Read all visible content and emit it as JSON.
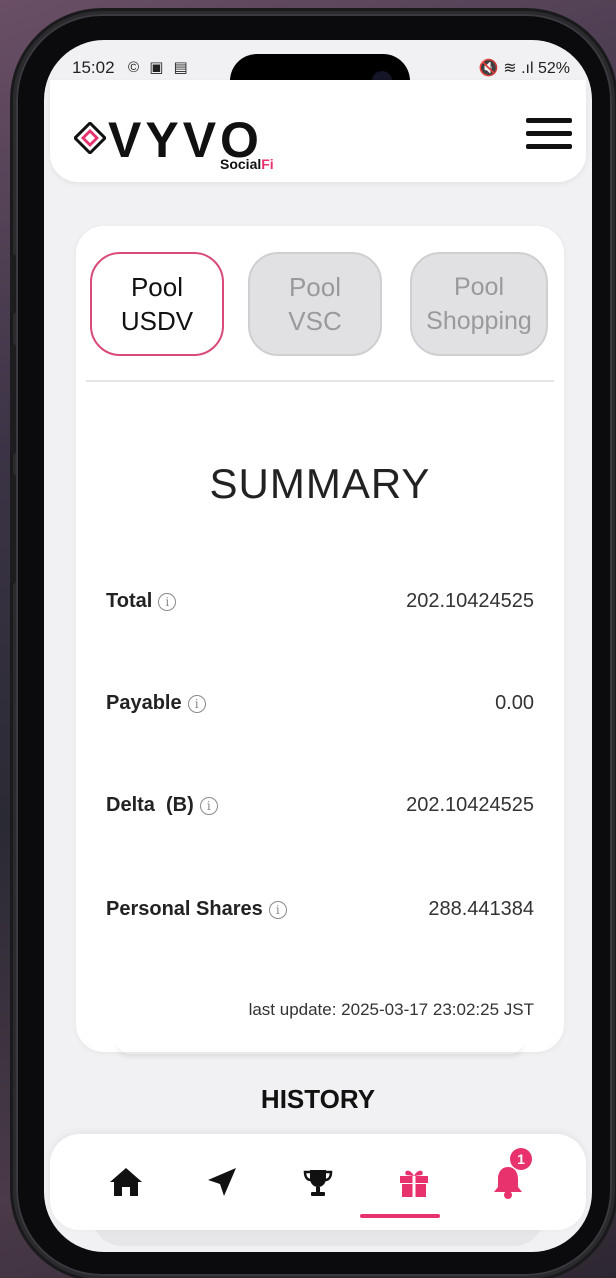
{
  "statusbar": {
    "time": "15:02",
    "left_icons": "© ▣ ▤",
    "right": "🔇 ≋ .ıl 52%"
  },
  "app": {
    "logo_text": "VYVO",
    "logo_sub_a": "Social",
    "logo_sub_b": "Fi",
    "accent": "#e8326e"
  },
  "tabs": [
    {
      "line1": "Pool",
      "line2": "USDV",
      "active": true
    },
    {
      "line1": "Pool",
      "line2": "VSC",
      "active": false
    },
    {
      "line1": "Pool",
      "line2": "Shopping",
      "active": false
    }
  ],
  "summary": {
    "title": "SUMMARY",
    "rows": [
      {
        "label": "Total",
        "value": "202.10424525"
      },
      {
        "label": "Payable",
        "value": "0.00"
      },
      {
        "label": "Delta  (B)",
        "value": "202.10424525"
      },
      {
        "label": "Personal Shares",
        "value": "288.441384"
      }
    ],
    "info_glyph": "i",
    "last_update": "last update: 2025-03-17 23:02:25 JST"
  },
  "history": {
    "title": "HISTORY"
  },
  "nav": {
    "items": [
      "home-icon",
      "send-icon",
      "trophy-icon",
      "gift-icon",
      "bell-icon"
    ],
    "active": "gift-icon",
    "notification_count": "1"
  }
}
